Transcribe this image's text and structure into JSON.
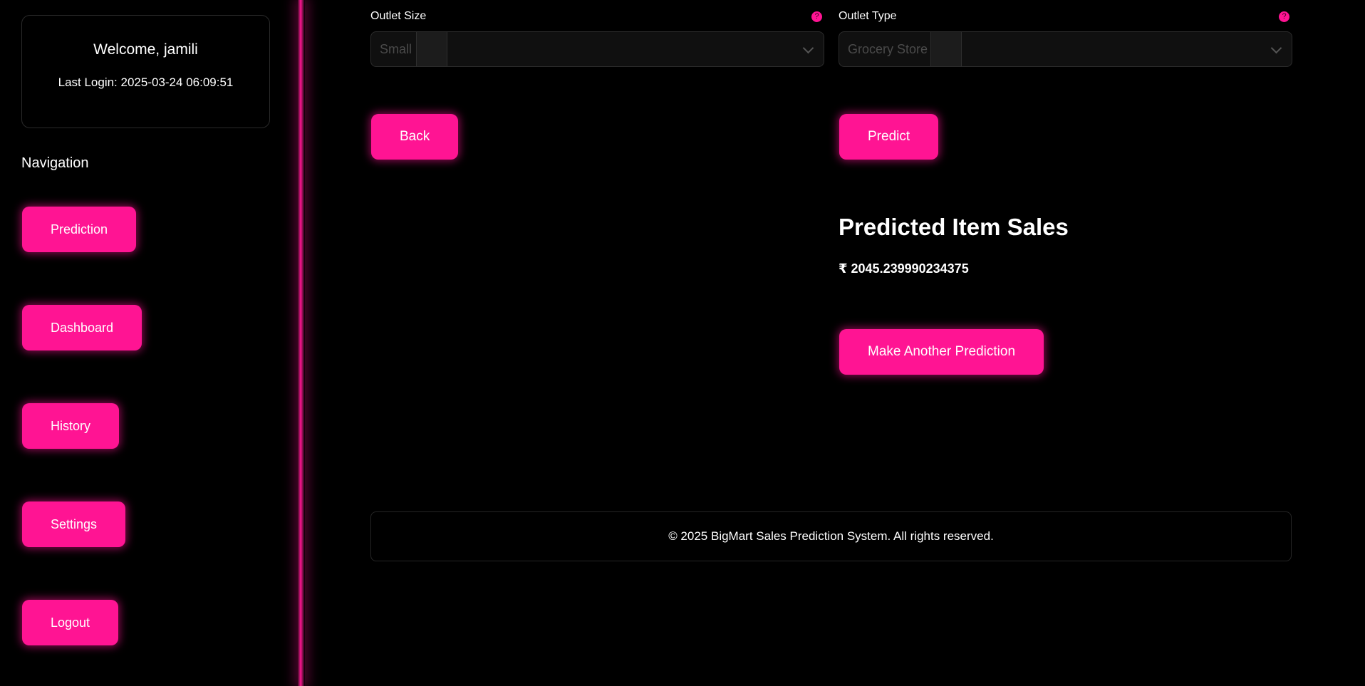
{
  "sidebar": {
    "welcome": "Welcome, jamili",
    "last_login": "Last Login: 2025-03-24 06:09:51",
    "nav_heading": "Navigation",
    "items": [
      {
        "label": "Prediction"
      },
      {
        "label": "Dashboard"
      },
      {
        "label": "History"
      },
      {
        "label": "Settings"
      },
      {
        "label": "Logout"
      }
    ]
  },
  "form": {
    "outlet_size": {
      "label": "Outlet Size",
      "value": "Small",
      "help": "?"
    },
    "outlet_type": {
      "label": "Outlet Type",
      "value": "Grocery Store",
      "help": "?"
    },
    "back_label": "Back",
    "predict_label": "Predict"
  },
  "result": {
    "title": "Predicted Item Sales",
    "value": "₹ 2045.239990234375",
    "again_label": "Make Another Prediction"
  },
  "footer": {
    "text": "© 2025 BigMart Sales Prediction System. All rights reserved."
  },
  "colors": {
    "accent": "#ff1493",
    "background": "#000000"
  }
}
